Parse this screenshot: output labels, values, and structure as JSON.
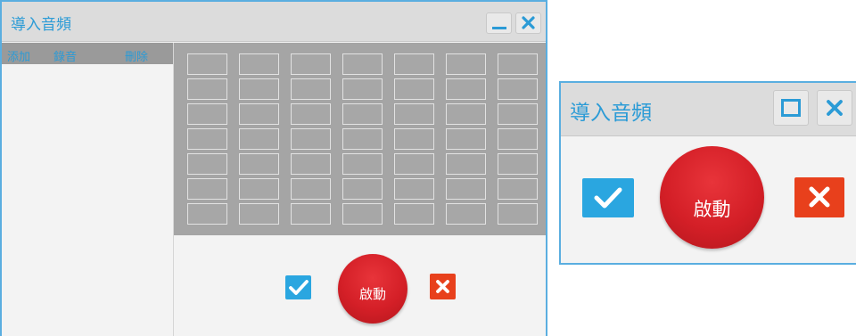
{
  "main_window": {
    "title": "導入音頻",
    "toolbar": {
      "add_label": "添加",
      "record_label": "錄音",
      "delete_label": "刪除"
    },
    "grid": {
      "rows": 7,
      "columns": 7
    },
    "start_label": "啟動"
  },
  "dialog": {
    "title": "導入音頻",
    "start_label": "啟動"
  },
  "colors": {
    "accent": "#2b9bd6",
    "confirm": "#2aa6e0",
    "cancel": "#e8401c",
    "start": "#d41f27"
  }
}
